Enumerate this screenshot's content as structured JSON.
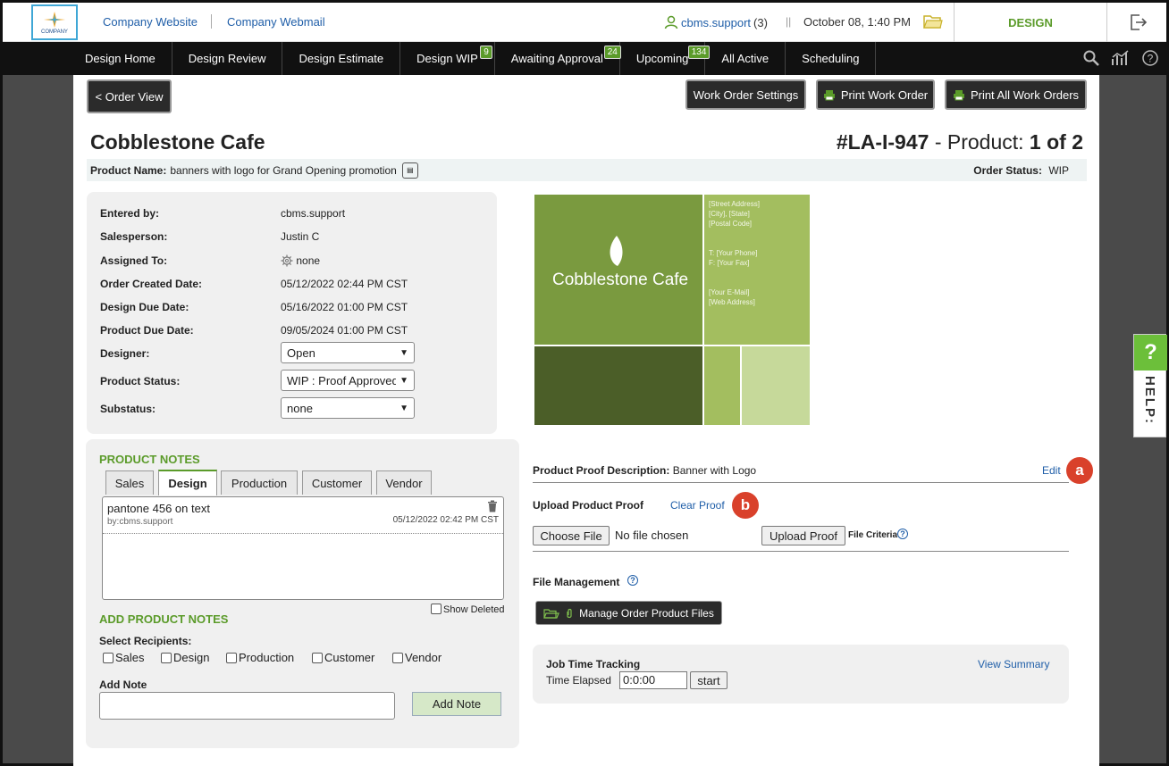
{
  "topbar": {
    "logo_text": "COMPANY",
    "company_website": "Company Website",
    "company_webmail": "Company Webmail",
    "user": "cbms.support",
    "user_count": "(3)",
    "sep": "||",
    "datetime": "October 08, 1:40 PM",
    "design_tab": "DESIGN"
  },
  "nav": {
    "items": [
      {
        "label": "Design Home"
      },
      {
        "label": "Design Review"
      },
      {
        "label": "Design Estimate"
      },
      {
        "label": "Design WIP",
        "badge": "9"
      },
      {
        "label": "Awaiting Approval",
        "badge": "24"
      },
      {
        "label": "Upcoming",
        "badge": "134"
      },
      {
        "label": "All Active"
      },
      {
        "label": "Scheduling"
      }
    ]
  },
  "toolbar": {
    "order_view": "< Order View",
    "work_order_settings": "Work Order Settings",
    "print_work_order": "Print Work Order",
    "print_all_work_orders": "Print All Work Orders"
  },
  "header": {
    "customer": "Cobblestone Cafe",
    "order_no": "#LA-I-947",
    "product_sep": "- Product:",
    "product_of": "1 of 2",
    "product_name_label": "Product Name:",
    "product_name": "banners with logo for Grand Opening promotion",
    "order_status_label": "Order Status:",
    "order_status": "WIP"
  },
  "info": {
    "entered_by_label": "Entered by:",
    "entered_by": "cbms.support",
    "salesperson_label": "Salesperson:",
    "salesperson": "Justin C",
    "assigned_to_label": "Assigned To:",
    "assigned_to": "none",
    "order_created_label": "Order Created Date:",
    "order_created": "05/12/2022 02:44 PM CST",
    "design_due_label": "Design Due Date:",
    "design_due": "05/16/2022 01:00 PM CST",
    "product_due_label": "Product Due Date:",
    "product_due": "09/05/2024 01:00 PM CST",
    "designer_label": "Designer:",
    "designer": "Open",
    "product_status_label": "Product Status:",
    "product_status": "WIP : Proof Approved",
    "substatus_label": "Substatus:",
    "substatus": "none"
  },
  "notes": {
    "heading": "PRODUCT NOTES",
    "tabs": [
      "Sales",
      "Design",
      "Production",
      "Customer",
      "Vendor"
    ],
    "active_tab": "Design",
    "note_text": "pantone 456 on text",
    "note_by": "by:cbms.support",
    "note_date": "05/12/2022 02:42 PM CST",
    "show_deleted": "Show Deleted",
    "add_heading": "ADD PRODUCT NOTES",
    "select_recipients": "Select Recipients:",
    "recipients": [
      "Sales",
      "Design",
      "Production",
      "Customer",
      "Vendor"
    ],
    "add_note_label": "Add Note",
    "add_note_button": "Add Note"
  },
  "proof": {
    "image_title": "Cobblestone Cafe",
    "image_lines": [
      "[Street Address]",
      "[City], [State]",
      "[Postal Code]",
      "T: [Your Phone]",
      "F: [Your Fax]",
      "[Your E-Mail]",
      "[Web Address]"
    ],
    "description_label": "Product Proof Description:",
    "description": "Banner with Logo",
    "edit": "Edit",
    "callout_a": "a",
    "upload_label": "Upload Product Proof",
    "clear_proof": "Clear Proof",
    "callout_b": "b",
    "choose_file": "Choose File",
    "no_file": "No file chosen",
    "upload_proof": "Upload Proof",
    "file_criteria": "File Criteria",
    "file_mgmt_label": "File Management",
    "manage_files": "Manage Order Product Files"
  },
  "jtt": {
    "heading": "Job Time Tracking",
    "elapsed_label": "Time Elapsed",
    "elapsed_value": "0:0:00",
    "start": "start",
    "view_summary": "View Summary"
  },
  "help": {
    "q": "?",
    "label": "HELP:"
  },
  "colors": {
    "accent_green": "#5b9b2a",
    "link_blue": "#1f5ea8",
    "callout_red": "#d9412b",
    "nav_bg": "#111111"
  }
}
